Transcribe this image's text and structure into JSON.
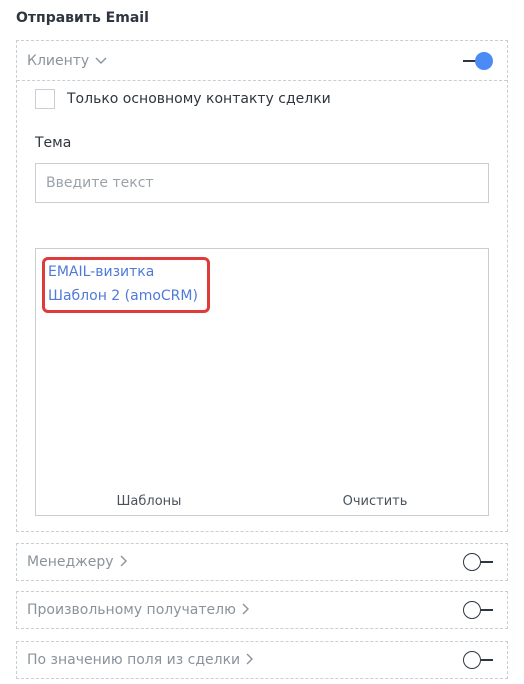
{
  "title": "Отправить Email",
  "client": {
    "label": "Клиенту",
    "chevron": "chevron-down-icon",
    "enabled": true,
    "only_main_contact_label": "Только основному контакту сделки",
    "subject_label": "Тема",
    "subject_value": "",
    "subject_placeholder": "Введите текст",
    "templates": [
      {
        "label": "EMAIL-визитка"
      },
      {
        "label": "Шаблон 2 (amoCRM)"
      }
    ],
    "footer": {
      "templates_label": "Шаблоны",
      "clear_label": "Очистить"
    }
  },
  "sections": [
    {
      "label": "Менеджеру",
      "chevron": "chevron-right-icon",
      "enabled": false
    },
    {
      "label": "Произвольному получателю",
      "chevron": "chevron-right-icon",
      "enabled": false
    },
    {
      "label": "По значению поля из сделки",
      "chevron": "chevron-right-icon",
      "enabled": false
    }
  ],
  "colors": {
    "accent": "#4c8bf5",
    "link": "#4f7ad9",
    "highlight": "#e03b3b"
  }
}
